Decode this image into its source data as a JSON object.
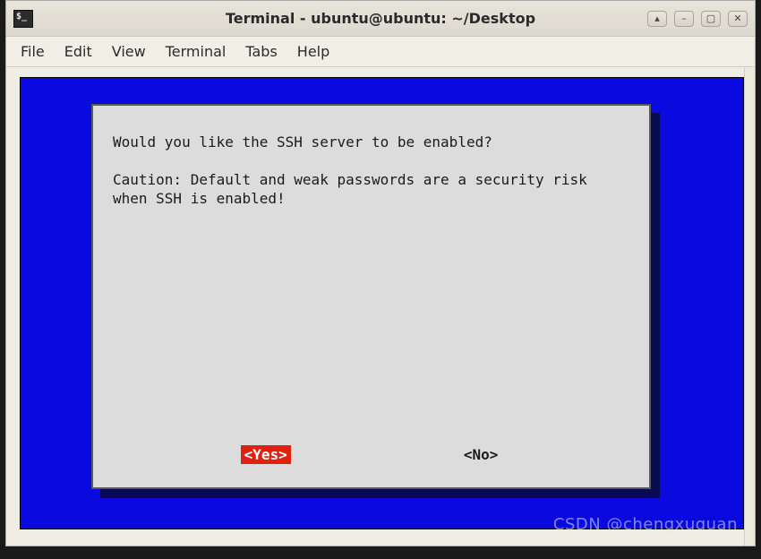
{
  "window": {
    "title": "Terminal - ubuntu@ubuntu: ~/Desktop"
  },
  "window_controls": {
    "rollup": "▴",
    "minimize": "–",
    "maximize": "▢",
    "close": "✕"
  },
  "menubar": {
    "items": [
      {
        "label": "File"
      },
      {
        "label": "Edit"
      },
      {
        "label": "View"
      },
      {
        "label": "Terminal"
      },
      {
        "label": "Tabs"
      },
      {
        "label": "Help"
      }
    ]
  },
  "dialog": {
    "line1": "Would you like the SSH server to be enabled?",
    "line2": "Caution: Default and weak passwords are a security risk when SSH is enabled!",
    "buttons": {
      "yes": "<Yes>",
      "no": "<No>",
      "selected": "yes"
    }
  },
  "watermark": "CSDN @chengxuquan"
}
